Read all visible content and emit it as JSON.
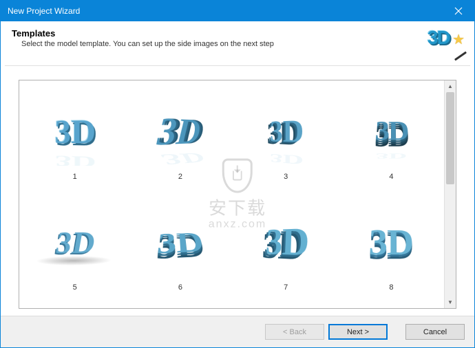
{
  "window": {
    "title": "New Project Wizard"
  },
  "header": {
    "title": "Templates",
    "subtitle": "Select the model template. You can set up the side images on the next step",
    "icon_text": "3D"
  },
  "templates": {
    "glyph": "3D",
    "items": [
      {
        "label": "1"
      },
      {
        "label": "2"
      },
      {
        "label": "3"
      },
      {
        "label": "4"
      },
      {
        "label": "5"
      },
      {
        "label": "6"
      },
      {
        "label": "7"
      },
      {
        "label": "8"
      }
    ]
  },
  "buttons": {
    "back": "< Back",
    "next": "Next >",
    "cancel": "Cancel"
  },
  "watermark": {
    "line1": "安下载",
    "line2": "anxz.com"
  }
}
